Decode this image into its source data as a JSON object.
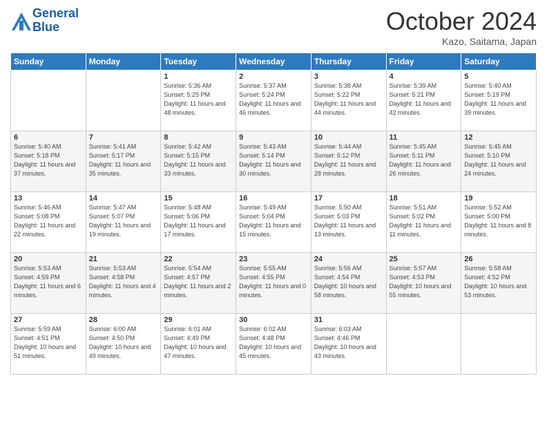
{
  "header": {
    "logo_line1": "General",
    "logo_line2": "Blue",
    "month": "October 2024",
    "location": "Kazo, Saitama, Japan"
  },
  "weekdays": [
    "Sunday",
    "Monday",
    "Tuesday",
    "Wednesday",
    "Thursday",
    "Friday",
    "Saturday"
  ],
  "weeks": [
    [
      {
        "day": "",
        "info": ""
      },
      {
        "day": "",
        "info": ""
      },
      {
        "day": "1",
        "info": "Sunrise: 5:36 AM\nSunset: 5:25 PM\nDaylight: 11 hours and 48 minutes."
      },
      {
        "day": "2",
        "info": "Sunrise: 5:37 AM\nSunset: 5:24 PM\nDaylight: 11 hours and 46 minutes."
      },
      {
        "day": "3",
        "info": "Sunrise: 5:38 AM\nSunset: 5:22 PM\nDaylight: 11 hours and 44 minutes."
      },
      {
        "day": "4",
        "info": "Sunrise: 5:39 AM\nSunset: 5:21 PM\nDaylight: 11 hours and 42 minutes."
      },
      {
        "day": "5",
        "info": "Sunrise: 5:40 AM\nSunset: 5:19 PM\nDaylight: 11 hours and 39 minutes."
      }
    ],
    [
      {
        "day": "6",
        "info": "Sunrise: 5:40 AM\nSunset: 5:18 PM\nDaylight: 11 hours and 37 minutes."
      },
      {
        "day": "7",
        "info": "Sunrise: 5:41 AM\nSunset: 5:17 PM\nDaylight: 11 hours and 35 minutes."
      },
      {
        "day": "8",
        "info": "Sunrise: 5:42 AM\nSunset: 5:15 PM\nDaylight: 11 hours and 33 minutes."
      },
      {
        "day": "9",
        "info": "Sunrise: 5:43 AM\nSunset: 5:14 PM\nDaylight: 11 hours and 30 minutes."
      },
      {
        "day": "10",
        "info": "Sunrise: 5:44 AM\nSunset: 5:12 PM\nDaylight: 11 hours and 28 minutes."
      },
      {
        "day": "11",
        "info": "Sunrise: 5:45 AM\nSunset: 5:11 PM\nDaylight: 11 hours and 26 minutes."
      },
      {
        "day": "12",
        "info": "Sunrise: 5:45 AM\nSunset: 5:10 PM\nDaylight: 11 hours and 24 minutes."
      }
    ],
    [
      {
        "day": "13",
        "info": "Sunrise: 5:46 AM\nSunset: 5:08 PM\nDaylight: 11 hours and 22 minutes."
      },
      {
        "day": "14",
        "info": "Sunrise: 5:47 AM\nSunset: 5:07 PM\nDaylight: 11 hours and 19 minutes."
      },
      {
        "day": "15",
        "info": "Sunrise: 5:48 AM\nSunset: 5:06 PM\nDaylight: 11 hours and 17 minutes."
      },
      {
        "day": "16",
        "info": "Sunrise: 5:49 AM\nSunset: 5:04 PM\nDaylight: 11 hours and 15 minutes."
      },
      {
        "day": "17",
        "info": "Sunrise: 5:50 AM\nSunset: 5:03 PM\nDaylight: 11 hours and 13 minutes."
      },
      {
        "day": "18",
        "info": "Sunrise: 5:51 AM\nSunset: 5:02 PM\nDaylight: 11 hours and 11 minutes."
      },
      {
        "day": "19",
        "info": "Sunrise: 5:52 AM\nSunset: 5:00 PM\nDaylight: 11 hours and 8 minutes."
      }
    ],
    [
      {
        "day": "20",
        "info": "Sunrise: 5:53 AM\nSunset: 4:59 PM\nDaylight: 11 hours and 6 minutes."
      },
      {
        "day": "21",
        "info": "Sunrise: 5:53 AM\nSunset: 4:58 PM\nDaylight: 11 hours and 4 minutes."
      },
      {
        "day": "22",
        "info": "Sunrise: 5:54 AM\nSunset: 4:57 PM\nDaylight: 11 hours and 2 minutes."
      },
      {
        "day": "23",
        "info": "Sunrise: 5:55 AM\nSunset: 4:55 PM\nDaylight: 11 hours and 0 minutes."
      },
      {
        "day": "24",
        "info": "Sunrise: 5:56 AM\nSunset: 4:54 PM\nDaylight: 10 hours and 58 minutes."
      },
      {
        "day": "25",
        "info": "Sunrise: 5:57 AM\nSunset: 4:53 PM\nDaylight: 10 hours and 55 minutes."
      },
      {
        "day": "26",
        "info": "Sunrise: 5:58 AM\nSunset: 4:52 PM\nDaylight: 10 hours and 53 minutes."
      }
    ],
    [
      {
        "day": "27",
        "info": "Sunrise: 5:59 AM\nSunset: 4:51 PM\nDaylight: 10 hours and 51 minutes."
      },
      {
        "day": "28",
        "info": "Sunrise: 6:00 AM\nSunset: 4:50 PM\nDaylight: 10 hours and 49 minutes."
      },
      {
        "day": "29",
        "info": "Sunrise: 6:01 AM\nSunset: 4:49 PM\nDaylight: 10 hours and 47 minutes."
      },
      {
        "day": "30",
        "info": "Sunrise: 6:02 AM\nSunset: 4:48 PM\nDaylight: 10 hours and 45 minutes."
      },
      {
        "day": "31",
        "info": "Sunrise: 6:03 AM\nSunset: 4:46 PM\nDaylight: 10 hours and 43 minutes."
      },
      {
        "day": "",
        "info": ""
      },
      {
        "day": "",
        "info": ""
      }
    ]
  ]
}
